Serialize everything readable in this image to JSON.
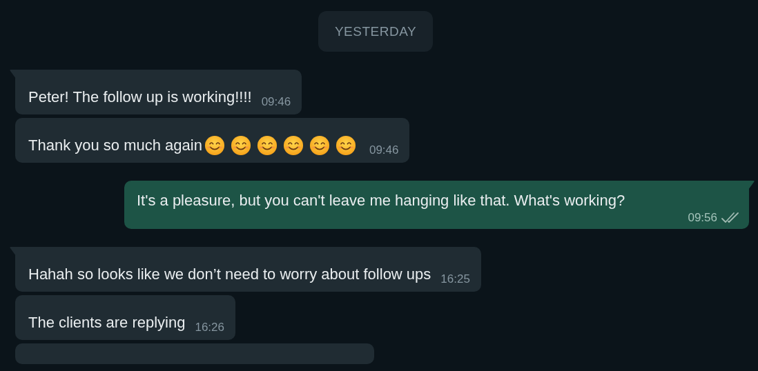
{
  "date_divider": "YESTERDAY",
  "messages": [
    {
      "outgoing": false,
      "tail": true,
      "text": "Peter! The follow up is working!!!!",
      "time": "09:46"
    },
    {
      "outgoing": false,
      "tail": false,
      "text": "Thank you so much again",
      "emojis": [
        {
          "kind": "smile"
        },
        {
          "kind": "smile"
        },
        {
          "kind": "smile"
        },
        {
          "kind": "smile"
        },
        {
          "kind": "smile"
        },
        {
          "kind": "smile"
        }
      ],
      "time": "09:46"
    },
    {
      "outgoing": true,
      "tail": true,
      "text": "It's a pleasure, but you can't leave me hanging like that. What's working?",
      "time": "09:56",
      "read": false
    },
    {
      "outgoing": false,
      "tail": true,
      "text": "Hahah so looks like we don’t need to worry about follow ups",
      "time": "16:25"
    },
    {
      "outgoing": false,
      "tail": false,
      "text": "The clients are replying",
      "time": "16:26"
    },
    {
      "outgoing": false,
      "tail": false
    }
  ]
}
